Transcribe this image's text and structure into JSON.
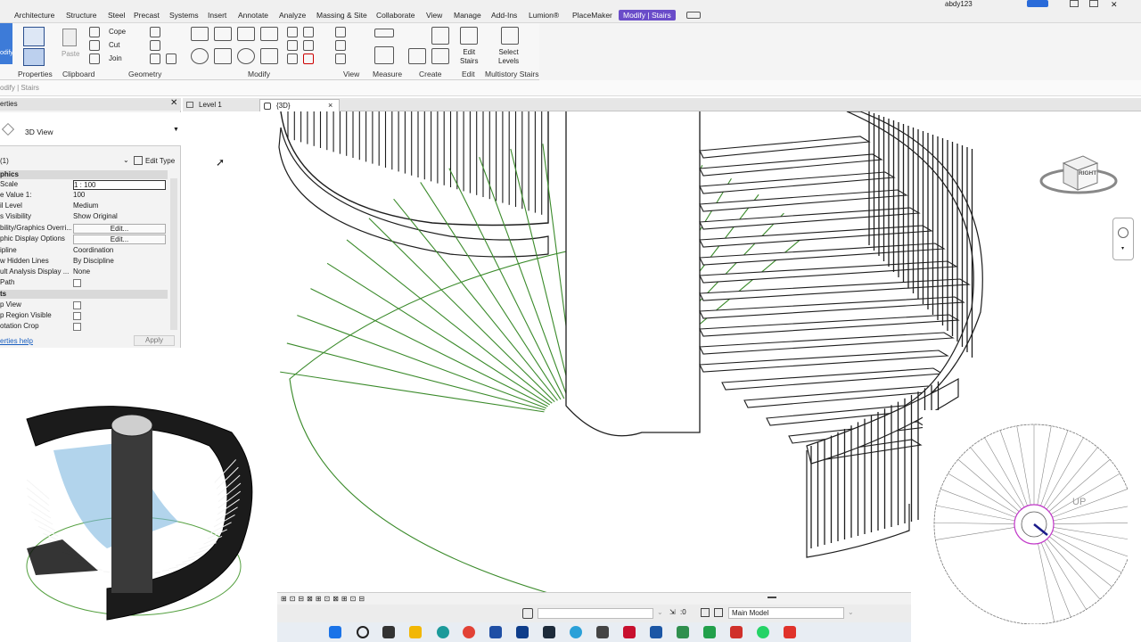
{
  "ribbon": {
    "tabs": [
      "Architecture",
      "Structure",
      "Steel",
      "Precast",
      "Systems",
      "Insert",
      "Annotate",
      "Analyze",
      "Massing & Site",
      "Collaborate",
      "View",
      "Manage",
      "Add-Ins",
      "Lumion®",
      "PlaceMaker",
      "Modify | Stairs"
    ],
    "active_tab": "Modify | Stairs",
    "user": "abdy123",
    "groups": [
      "Properties",
      "Clipboard",
      "Geometry",
      "Modify",
      "View",
      "Measure",
      "Create",
      "Edit",
      "Multistory Stairs"
    ],
    "modify_button": "odify",
    "paste_label": "Paste",
    "cope_label": "Cope",
    "cut_label": "Cut",
    "join_label": "Join",
    "edit_stairs_label": "Edit\nStairs",
    "select_levels_label": "Select\nLevels",
    "context_text": "odify | Stairs"
  },
  "properties": {
    "title": "erties",
    "type_name": "3D View",
    "filter": "(1)",
    "edit_type": "Edit Type",
    "sections": [
      "phics",
      "ts"
    ],
    "rows": [
      {
        "k": "Scale",
        "v": "1 : 100"
      },
      {
        "k": "e Value   1:",
        "v": "100"
      },
      {
        "k": "il Level",
        "v": "Medium"
      },
      {
        "k": "s Visibility",
        "v": "Show Original"
      },
      {
        "k": "bility/Graphics Overri...",
        "v": "Edit..."
      },
      {
        "k": "phic Display Options",
        "v": "Edit..."
      },
      {
        "k": "ipline",
        "v": "Coordination"
      },
      {
        "k": "w Hidden Lines",
        "v": "By Discipline"
      },
      {
        "k": "ult Analysis Display ...",
        "v": "None"
      },
      {
        "k": "Path",
        "v": ""
      }
    ],
    "extents_rows": [
      "p View",
      "p Region Visible",
      "otation Crop"
    ],
    "help": "erties help",
    "apply": "Apply"
  },
  "view_tabs": [
    {
      "label": "Level 1"
    },
    {
      "label": "{3D}",
      "close": "×"
    }
  ],
  "viewcube": {
    "face": "RIGHT"
  },
  "inset_plan": {
    "label": "UP"
  },
  "statusbar": {
    "scale_hint": ":0",
    "model": "Main Model"
  },
  "colors": {
    "accent": "#6a4cc9",
    "green_lines": "#3a8a2a",
    "dark_lines": "#1e1e1e"
  }
}
